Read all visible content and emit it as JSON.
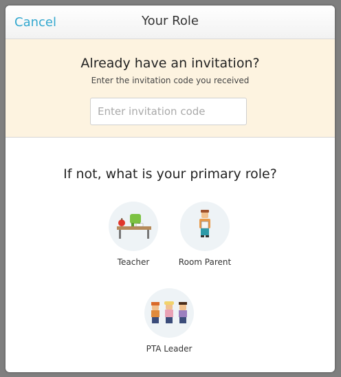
{
  "header": {
    "cancel_label": "Cancel",
    "title": "Your Role"
  },
  "invitation": {
    "heading": "Already have an invitation?",
    "subtext": "Enter the invitation code you received",
    "input_placeholder": "Enter invitation code",
    "input_value": ""
  },
  "roles": {
    "question": "If not, what is your primary role?",
    "items": [
      {
        "label": "Teacher",
        "icon": "teacher-desk-icon"
      },
      {
        "label": "Room Parent",
        "icon": "room-parent-icon"
      },
      {
        "label": "PTA Leader",
        "icon": "pta-leader-icon"
      }
    ]
  },
  "colors": {
    "accent": "#33a8cf",
    "invite_bg": "#fdf3e0",
    "circle_bg": "#eef3f6"
  }
}
